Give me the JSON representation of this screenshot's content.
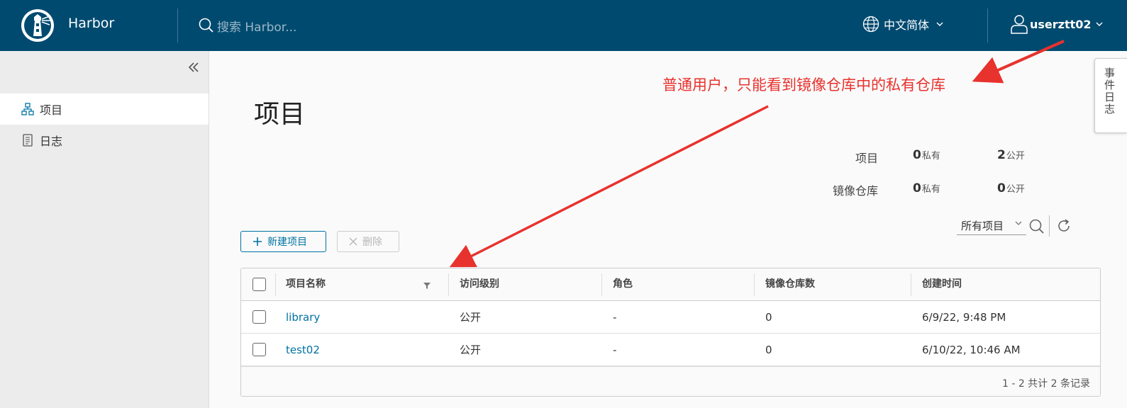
{
  "header": {
    "brand": "Harbor",
    "search_placeholder": "搜索 Harbor...",
    "language": "中文简体",
    "username": "userztt02",
    "logo_icon": "harbor-lighthouse-icon"
  },
  "sidebar": {
    "items": [
      {
        "label": "项目",
        "icon": "projects-icon",
        "active": true
      },
      {
        "label": "日志",
        "icon": "logs-icon",
        "active": false
      }
    ]
  },
  "main": {
    "title": "项目",
    "annotation": "普通用户，只能看到镜像仓库中的私有仓库",
    "stats": {
      "projects_label": "项目",
      "repos_label": "镜像仓库",
      "private_unit": "私有",
      "public_unit": "公开",
      "projects_private": "0",
      "projects_public": "2",
      "repos_private": "0",
      "repos_public": "0"
    },
    "filter": {
      "selected": "所有项目"
    },
    "buttons": {
      "new_project": "新建项目",
      "delete": "删除"
    },
    "table": {
      "columns": [
        "项目名称",
        "访问级别",
        "角色",
        "镜像仓库数",
        "创建时间"
      ],
      "rows": [
        {
          "name": "library",
          "access": "公开",
          "role": "-",
          "repo_count": "0",
          "created": "6/9/22, 9:48 PM"
        },
        {
          "name": "test02",
          "access": "公开",
          "role": "-",
          "repo_count": "0",
          "created": "6/10/22, 10:46 AM"
        }
      ],
      "footer": "1 - 2 共计 2 条记录"
    },
    "drawer_tab": "事件日志"
  },
  "colors": {
    "header_bg": "#004a70",
    "accent": "#0072a3",
    "annotation": "#e8322d"
  }
}
